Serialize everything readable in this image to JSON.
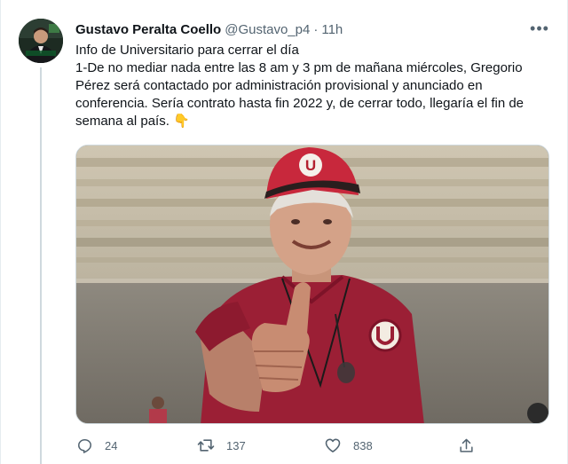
{
  "tweet": {
    "author_name": "Gustavo Peralta Coello",
    "handle": "@Gustavo_p4",
    "separator": "·",
    "time": "11h",
    "more_icon": "more-horizontal-icon",
    "lines": [
      "Info de Universitario para cerrar el día",
      "1-De no mediar nada entre las 8 am y 3 pm de mañana miércoles, Gregorio Pérez será contactado por administración provisional y anunciado en conferencia. Sería contrato hasta fin 2022 y, de cerrar todo, llegaría el fin de semana al país."
    ],
    "emoji": "👇",
    "media": {
      "description_icon": "photo",
      "cap_logo": "U"
    }
  },
  "actions": {
    "reply": {
      "icon": "reply-icon",
      "count": "24"
    },
    "retweet": {
      "icon": "retweet-icon",
      "count": "137"
    },
    "like": {
      "icon": "heart-icon",
      "count": "838"
    },
    "share": {
      "icon": "share-icon"
    }
  },
  "colors": {
    "text_primary": "#0f1419",
    "text_secondary": "#536471",
    "border": "#cfd9de",
    "jersey": "#9b1f35"
  }
}
